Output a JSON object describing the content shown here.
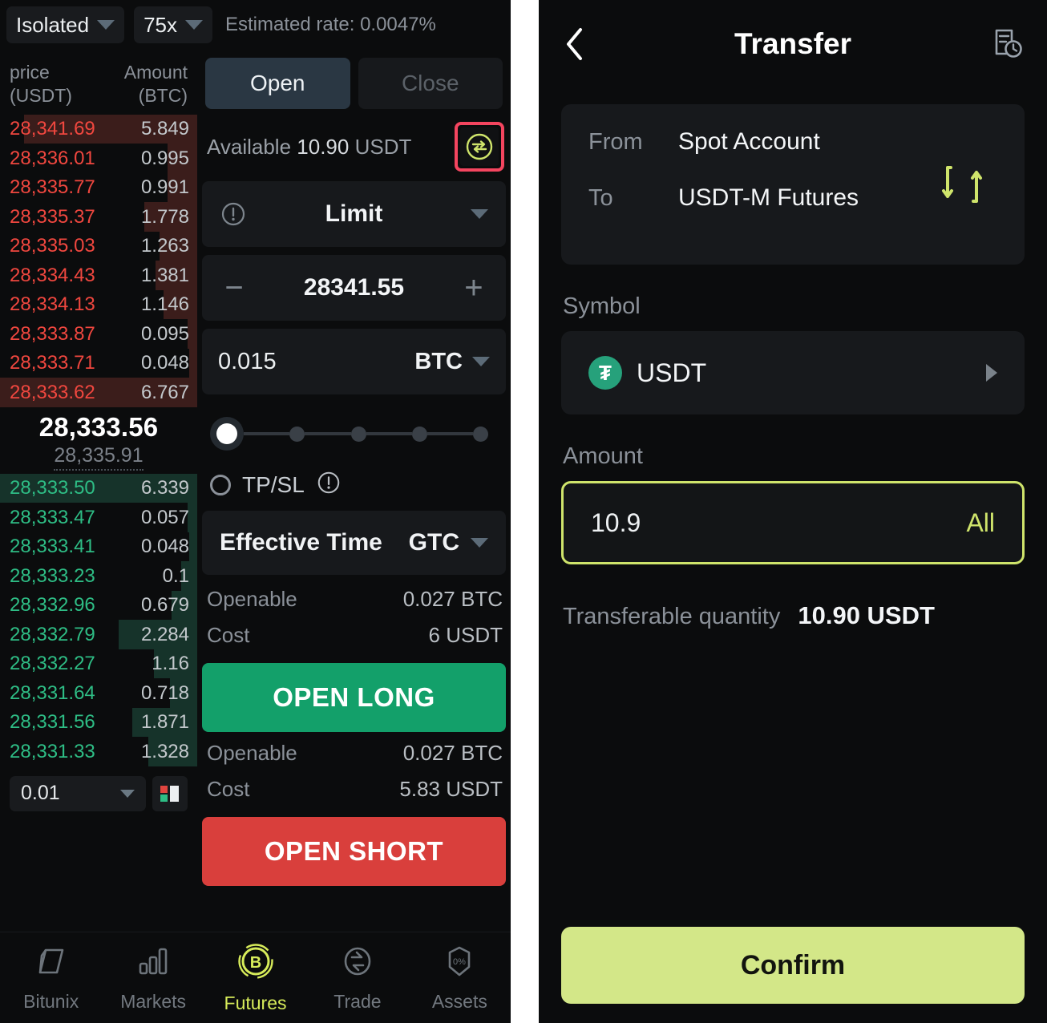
{
  "left": {
    "topbar": {
      "margin_mode": "Isolated",
      "leverage": "75x",
      "estimated_rate": "Estimated rate: 0.0047%"
    },
    "orderbook": {
      "col_price": "price\n(USDT)",
      "col_price_line1": "price",
      "col_price_line2": "(USDT)",
      "col_amount_line1": "Amount",
      "col_amount_line2": "(BTC)",
      "asks": [
        {
          "price": "28,341.69",
          "amount": "5.849",
          "depth": 88
        },
        {
          "price": "28,336.01",
          "amount": "0.995",
          "depth": 15
        },
        {
          "price": "28,335.77",
          "amount": "0.991",
          "depth": 15
        },
        {
          "price": "28,335.37",
          "amount": "1.778",
          "depth": 27
        },
        {
          "price": "28,335.03",
          "amount": "1.263",
          "depth": 19
        },
        {
          "price": "28,334.43",
          "amount": "1.381",
          "depth": 21
        },
        {
          "price": "28,334.13",
          "amount": "1.146",
          "depth": 17
        },
        {
          "price": "28,333.87",
          "amount": "0.095",
          "depth": 5
        },
        {
          "price": "28,333.71",
          "amount": "0.048",
          "depth": 4
        },
        {
          "price": "28,333.62",
          "amount": "6.767",
          "depth": 100
        }
      ],
      "mid_price": "28,333.56",
      "mark_price": "28,335.91",
      "bids": [
        {
          "price": "28,333.50",
          "amount": "6.339",
          "depth": 100
        },
        {
          "price": "28,333.47",
          "amount": "0.057",
          "depth": 5
        },
        {
          "price": "28,333.41",
          "amount": "0.048",
          "depth": 4
        },
        {
          "price": "28,333.23",
          "amount": "0.1",
          "depth": 8
        },
        {
          "price": "28,332.96",
          "amount": "0.679",
          "depth": 13
        },
        {
          "price": "28,332.79",
          "amount": "2.284",
          "depth": 40
        },
        {
          "price": "28,332.27",
          "amount": "1.16",
          "depth": 22
        },
        {
          "price": "28,331.64",
          "amount": "0.718",
          "depth": 14
        },
        {
          "price": "28,331.56",
          "amount": "1.871",
          "depth": 33
        },
        {
          "price": "28,331.33",
          "amount": "1.328",
          "depth": 25
        }
      ],
      "tick_size": "0.01",
      "depth_view_icon": "depth-layout-icon"
    },
    "form": {
      "tab_open": "Open",
      "tab_close": "Close",
      "available_label": "Available",
      "available_value": "10.90",
      "available_unit": "USDT",
      "transfer_icon": "transfer-circle-icon",
      "order_type": "Limit",
      "order_type_info_icon": "info-icon",
      "price_value": "28341.55",
      "minus": "−",
      "plus": "+",
      "qty_value": "0.015",
      "qty_unit": "BTC",
      "slider_positions": 5,
      "slider_active_index": 0,
      "tpsl_label": "TP/SL",
      "tpsl_info_icon": "info-icon",
      "effective_time_label": "Effective Time",
      "effective_time_value": "GTC",
      "long_openable_label": "Openable",
      "long_openable_value": "0.027 BTC",
      "long_cost_label": "Cost",
      "long_cost_value": "6 USDT",
      "open_long": "OPEN LONG",
      "short_openable_label": "Openable",
      "short_openable_value": "0.027 BTC",
      "short_cost_label": "Cost",
      "short_cost_value": "5.83 USDT",
      "open_short": "OPEN SHORT"
    },
    "nav": [
      {
        "label": "Bitunix",
        "icon": "cube-icon",
        "active": false
      },
      {
        "label": "Markets",
        "icon": "bar-chart-icon",
        "active": false
      },
      {
        "label": "Futures",
        "icon": "bitcoin-circle-icon",
        "active": true
      },
      {
        "label": "Trade",
        "icon": "swap-oval-icon",
        "active": false
      },
      {
        "label": "Assets",
        "icon": "wallet-icon",
        "active": false
      }
    ]
  },
  "right": {
    "header": {
      "back_icon": "back-chevron-icon",
      "title": "Transfer",
      "history_icon": "transfer-history-icon"
    },
    "transfer": {
      "from_label": "From",
      "from_value": "Spot Account",
      "to_label": "To",
      "to_value": "USDT-M Futures",
      "swap_icon": "swap-vertical-icon"
    },
    "symbol": {
      "section_label": "Symbol",
      "coin_badge": "usdt-tether-icon",
      "coin_badge_glyph": "₮",
      "name": "USDT",
      "chevron_icon": "chevron-right-icon"
    },
    "amount": {
      "section_label": "Amount",
      "value": "10.9",
      "placeholder": "0",
      "all_label": "All"
    },
    "transferable": {
      "label": "Transferable quantity",
      "value": "10.90 USDT"
    },
    "confirm_label": "Confirm"
  },
  "colors": {
    "accent_green": "#d7ec5a",
    "confirm_bg": "#d3e788",
    "long": "#13a06a",
    "short": "#d93f3c",
    "ask": "#f0473f",
    "bid": "#2ebd85",
    "highlight": "#f4455f"
  }
}
